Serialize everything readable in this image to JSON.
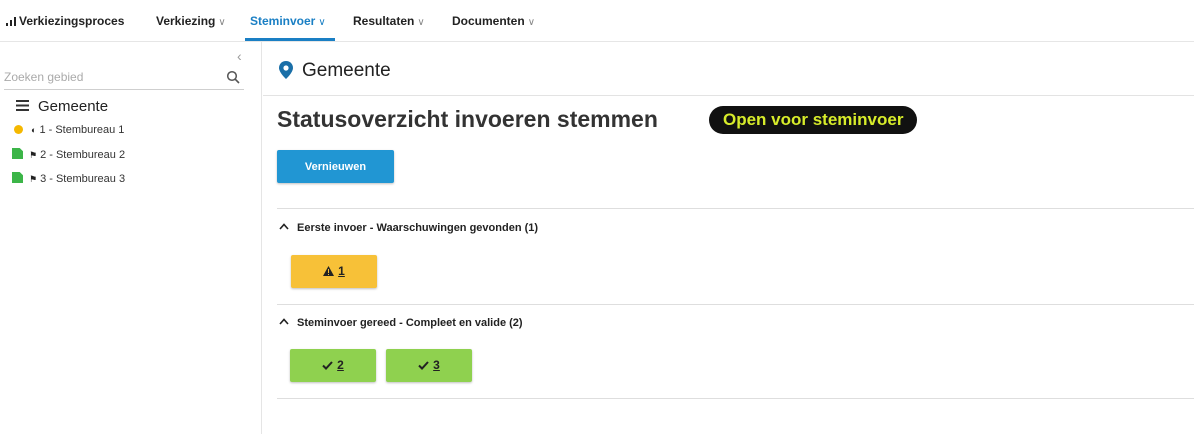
{
  "nav": {
    "items": [
      {
        "label": "Verkiezingsproces",
        "has_chevron": false,
        "active": false,
        "icon": "bar-chart-icon"
      },
      {
        "label": "Verkiezing",
        "has_chevron": true,
        "active": false
      },
      {
        "label": "Steminvoer",
        "has_chevron": true,
        "active": true
      },
      {
        "label": "Resultaten",
        "has_chevron": true,
        "active": false
      },
      {
        "label": "Documenten",
        "has_chevron": true,
        "active": false
      }
    ],
    "chevron": "∨",
    "accent_color": "#1a7fc4"
  },
  "sidebar": {
    "collapse_icon": "chevron-left-icon",
    "collapse_glyph": "‹",
    "search": {
      "placeholder": "Zoeken gebied",
      "value": ""
    },
    "root": {
      "label": "Gemeente",
      "icon": "list-icon"
    },
    "items": [
      {
        "label": "1 - Stembureau 1",
        "status": "warning",
        "status_color": "#f5b800",
        "icon": "half-circle-icon",
        "glyph": "◐"
      },
      {
        "label": "2 - Stembureau 2",
        "status": "complete",
        "status_color": "#3cb548",
        "icon": "flag-icon",
        "glyph": "⚑"
      },
      {
        "label": "3 - Stembureau 3",
        "status": "complete",
        "status_color": "#3cb548",
        "icon": "flag-icon",
        "glyph": "⚑"
      }
    ]
  },
  "main": {
    "location": {
      "label": "Gemeente",
      "icon": "map-pin-icon"
    },
    "title": "Statusoverzicht invoeren stemmen",
    "status_badge": "Open voor steminvoer",
    "refresh_button": "Vernieuwen",
    "sections": [
      {
        "heading": "Eerste invoer - Waarschuwingen gevonden (1)",
        "expanded": true,
        "chips": [
          {
            "number": "1",
            "icon": "warning-icon",
            "color": "#f7c138"
          }
        ]
      },
      {
        "heading": "Steminvoer gereed - Compleet en valide (2)",
        "expanded": true,
        "chips": [
          {
            "number": "2",
            "icon": "check-icon",
            "color": "#8fd14f"
          },
          {
            "number": "3",
            "icon": "check-icon",
            "color": "#8fd14f"
          }
        ]
      }
    ]
  }
}
